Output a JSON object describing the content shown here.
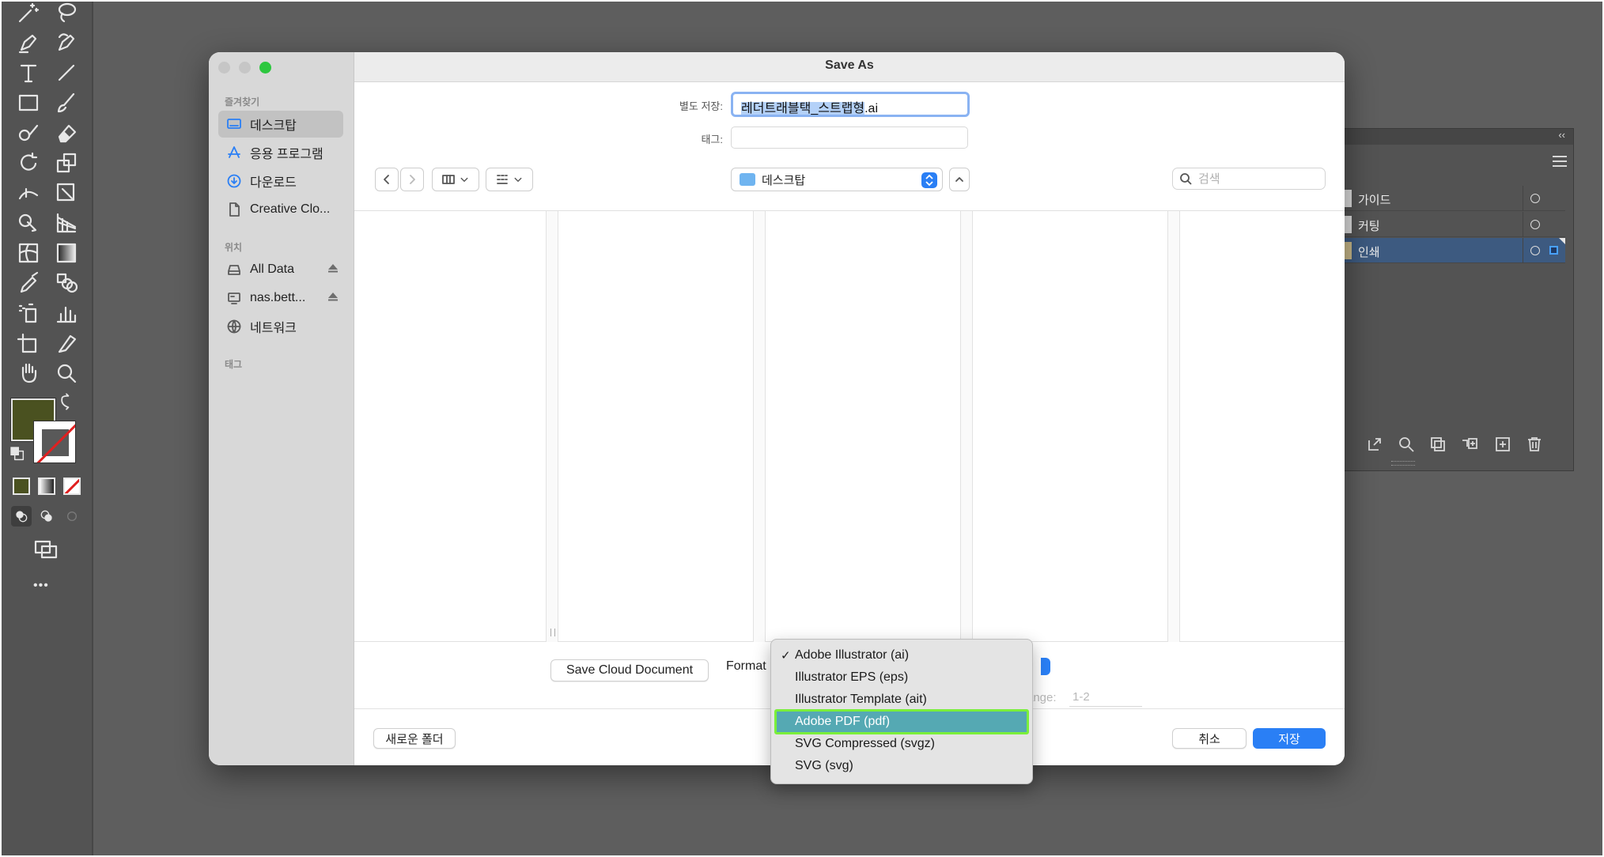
{
  "toolbar": {
    "tools": [
      "magic-wand-icon",
      "lasso-icon",
      "pen-icon",
      "curvature-icon",
      "type-icon",
      "line-segment-icon",
      "rectangle-icon",
      "paintbrush-icon",
      "shaper-icon",
      "eraser-icon",
      "rotate-icon",
      "scale-icon",
      "width-icon",
      "free-transform-icon",
      "shape-builder-icon",
      "perspective-grid-icon",
      "mesh-icon",
      "gradient-icon",
      "eyedropper-icon",
      "blend-icon",
      "symbol-sprayer-icon",
      "column-graph-icon",
      "artboard-icon",
      "slice-icon",
      "hand-icon",
      "zoom-icon"
    ],
    "more_label": "•••",
    "fill_color": "#4a5120"
  },
  "layers": {
    "collapse_label": "‹‹",
    "items": [
      {
        "name": "가이드",
        "selected": false
      },
      {
        "name": "커팅",
        "selected": false
      },
      {
        "name": "인쇄",
        "selected": true
      }
    ]
  },
  "dialog": {
    "title": "Save As",
    "sidebar": {
      "favorites_header": "즐겨찾기",
      "favorites": [
        {
          "label": "데스크탑",
          "icon": "desktop-icon",
          "active": true
        },
        {
          "label": "응용 프로그램",
          "icon": "applications-icon",
          "active": false
        },
        {
          "label": "다운로드",
          "icon": "downloads-icon",
          "active": false
        },
        {
          "label": "Creative Clo...",
          "icon": "document-icon",
          "active": false
        }
      ],
      "locations_header": "위치",
      "locations": [
        {
          "label": "All Data",
          "icon": "drive-icon",
          "eject": true
        },
        {
          "label": "nas.bett...",
          "icon": "server-icon",
          "eject": true
        },
        {
          "label": "네트워크",
          "icon": "network-icon",
          "eject": false
        }
      ],
      "tags_header": "태그"
    },
    "save_as_label": "별도 저장:",
    "filename_selected": "레더트래블택_스트랩형",
    "filename_ext": ".ai",
    "tags_label": "태그:",
    "location": "데스크탑",
    "search_placeholder": "검색",
    "save_cloud_label": "Save Cloud Document",
    "format_label": "Format",
    "range_label": "ange:",
    "range_value": "1-2",
    "new_folder_label": "새로운 폴더",
    "cancel_label": "취소",
    "save_label": "저장"
  },
  "format_menu": {
    "items": [
      {
        "label": "Adobe Illustrator (ai)",
        "checked": true
      },
      {
        "label": "Illustrator EPS (eps)",
        "checked": false
      },
      {
        "label": "Illustrator Template (ait)",
        "checked": false
      },
      {
        "label": "Adobe PDF (pdf)",
        "checked": false,
        "highlighted": true
      },
      {
        "label": "SVG Compressed (svgz)",
        "checked": false
      },
      {
        "label": "SVG (svg)",
        "checked": false
      }
    ],
    "check_mark": "✓"
  }
}
